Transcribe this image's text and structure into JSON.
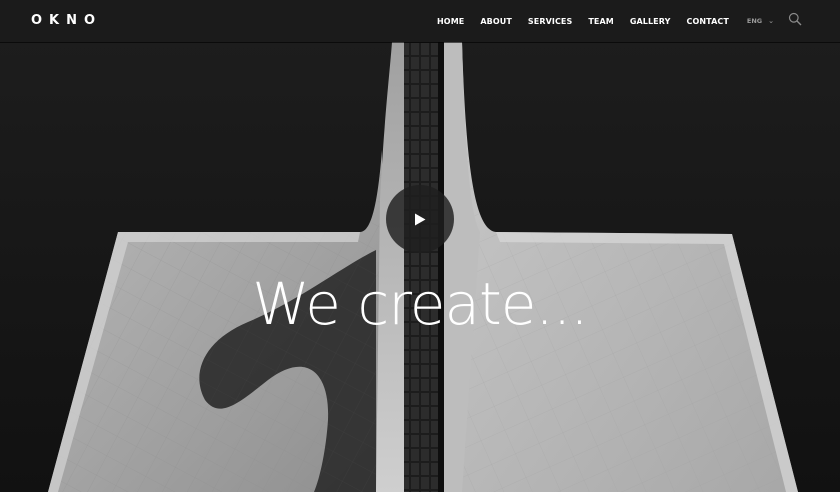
{
  "brand": {
    "logo": "OKNO"
  },
  "nav": {
    "items": [
      {
        "label": "HOME"
      },
      {
        "label": "ABOUT"
      },
      {
        "label": "SERVICES"
      },
      {
        "label": "TEAM"
      },
      {
        "label": "GALLERY"
      },
      {
        "label": "CONTACT"
      }
    ],
    "language": "ENG",
    "icons": [
      "chevron-down-icon",
      "search-icon"
    ]
  },
  "hero": {
    "headline": "We create...",
    "background": "black-and-white architecture photo",
    "play_icon": "play-icon"
  },
  "colors": {
    "navbar": "#1b1b1b",
    "text": "#ffffff",
    "muted": "#9a9a9a"
  }
}
